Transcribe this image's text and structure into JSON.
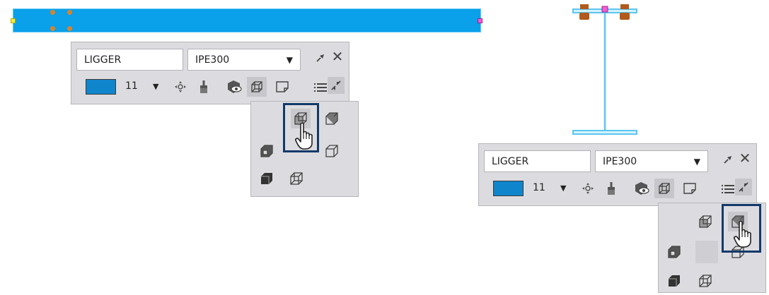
{
  "panel_left": {
    "name_value": "LIGGER",
    "profile_value": "IPE300",
    "profile_arrow": "▼",
    "class_number": "11",
    "class_arrow": "▼",
    "color": "#0f86cc"
  },
  "panel_right": {
    "name_value": "LIGGER",
    "profile_value": "IPE300",
    "profile_arrow": "▼",
    "class_number": "11",
    "class_arrow": "▼",
    "color": "#0f86cc"
  },
  "icons": {
    "pin": "pin-icon",
    "close": "close-icon",
    "move": "move-icon",
    "brush": "brush-icon",
    "visibility": "visibility-icon",
    "render_mode": "wireframe-cube-icon",
    "note": "note-icon",
    "list": "list-icon",
    "collapse": "collapse-icon",
    "cursor": "hand-pointer-icon"
  },
  "close_glyph": "✕",
  "colors": {
    "beam_fill": "#0aa0ea",
    "section_line": "#5ac7f0",
    "bolt": "#b15a1c",
    "highlight": "#13396a"
  }
}
